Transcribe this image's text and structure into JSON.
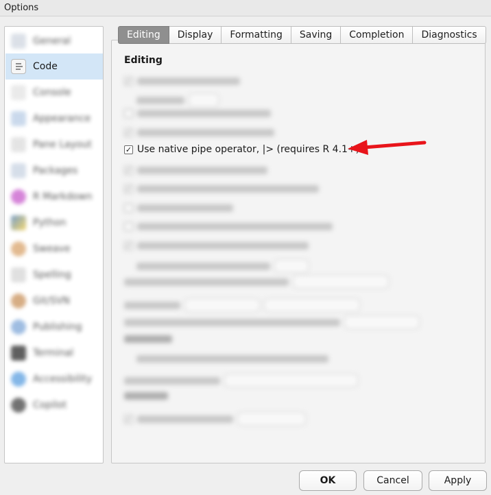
{
  "window": {
    "title": "Options"
  },
  "sidebar": {
    "items": [
      {
        "label": "General",
        "icon": "r-general-icon",
        "selected": false
      },
      {
        "label": "Code",
        "icon": "code-icon",
        "selected": true
      },
      {
        "label": "Console",
        "icon": "console-icon",
        "selected": false
      },
      {
        "label": "Appearance",
        "icon": "appearance-icon",
        "selected": false
      },
      {
        "label": "Pane Layout",
        "icon": "pane-layout-icon",
        "selected": false
      },
      {
        "label": "Packages",
        "icon": "packages-icon",
        "selected": false
      },
      {
        "label": "R Markdown",
        "icon": "rmarkdown-icon",
        "selected": false
      },
      {
        "label": "Python",
        "icon": "python-icon",
        "selected": false
      },
      {
        "label": "Sweave",
        "icon": "sweave-icon",
        "selected": false
      },
      {
        "label": "Spelling",
        "icon": "spelling-icon",
        "selected": false
      },
      {
        "label": "Git/SVN",
        "icon": "git-icon",
        "selected": false
      },
      {
        "label": "Publishing",
        "icon": "publishing-icon",
        "selected": false
      },
      {
        "label": "Terminal",
        "icon": "terminal-icon",
        "selected": false
      },
      {
        "label": "Accessibility",
        "icon": "accessibility-icon",
        "selected": false
      },
      {
        "label": "Copilot",
        "icon": "copilot-icon",
        "selected": false
      }
    ]
  },
  "tabs": [
    {
      "label": "Editing",
      "active": true
    },
    {
      "label": "Display",
      "active": false
    },
    {
      "label": "Formatting",
      "active": false
    },
    {
      "label": "Saving",
      "active": false
    },
    {
      "label": "Completion",
      "active": false
    },
    {
      "label": "Diagnostics",
      "active": false
    }
  ],
  "editing": {
    "section_title": "Editing",
    "native_pipe": {
      "label": "Use native pipe operator, |> (requires R 4.1+)",
      "checked": true
    }
  },
  "buttons": {
    "ok": "OK",
    "cancel": "Cancel",
    "apply": "Apply"
  },
  "colors": {
    "selected_bg": "#d3e6f7",
    "active_tab": "#8f8f8f",
    "arrow": "#e8141a"
  }
}
